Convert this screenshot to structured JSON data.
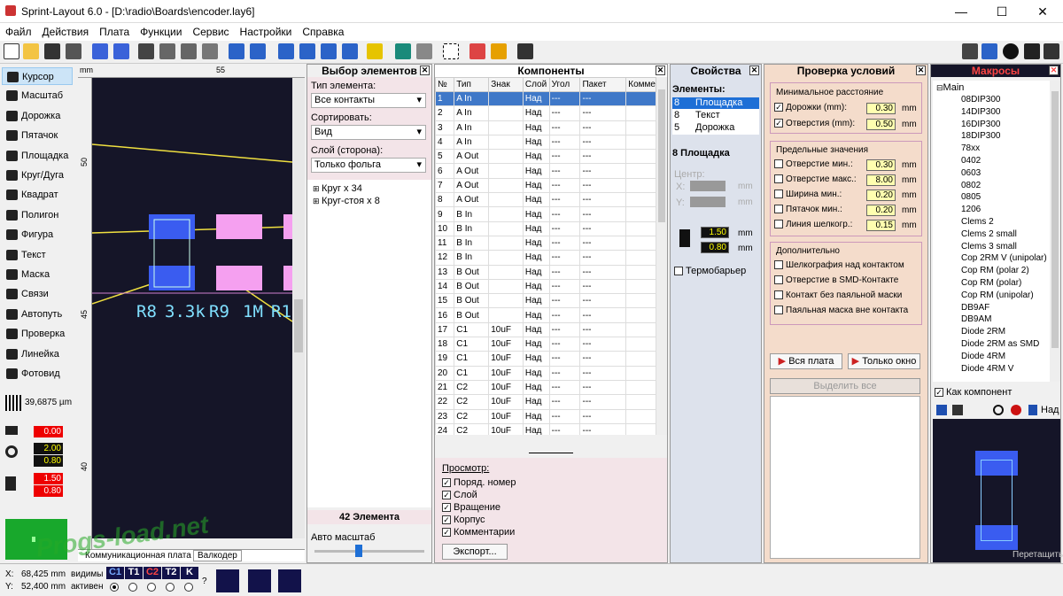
{
  "window": {
    "title": "Sprint-Layout 6.0 - [D:\\radio\\Boards\\encoder.lay6]",
    "min": "—",
    "max": "☐",
    "close": "✕"
  },
  "menu": [
    "Файл",
    "Действия",
    "Плата",
    "Функции",
    "Сервис",
    "Настройки",
    "Справка"
  ],
  "tools": [
    {
      "label": "Курсор",
      "icon": "cursor-icon",
      "active": true
    },
    {
      "label": "Масштаб",
      "icon": "zoom-icon"
    },
    {
      "label": "Дорожка",
      "icon": "track-icon"
    },
    {
      "label": "Пятачок",
      "icon": "pad-icon"
    },
    {
      "label": "Площадка",
      "icon": "smd-pad-icon"
    },
    {
      "label": "Круг/Дуга",
      "icon": "circle-icon"
    },
    {
      "label": "Квадрат",
      "icon": "square-icon"
    },
    {
      "label": "Полигон",
      "icon": "polygon-icon"
    },
    {
      "label": "Фигура",
      "icon": "shape-icon"
    },
    {
      "label": "Текст",
      "icon": "text-icon"
    },
    {
      "label": "Маска",
      "icon": "mask-icon"
    },
    {
      "label": "Связи",
      "icon": "connections-icon"
    },
    {
      "label": "Автопуть",
      "icon": "autoroute-icon"
    },
    {
      "label": "Проверка",
      "icon": "check-icon"
    },
    {
      "label": "Линейка",
      "icon": "ruler-icon"
    },
    {
      "label": "Фотовид",
      "icon": "photo-icon"
    }
  ],
  "grid": {
    "value": "39,6875 µm"
  },
  "left_fields": {
    "track_width": "0.00",
    "pad_outer": "2.00",
    "pad_inner": "0.80",
    "smd_w": "1.50",
    "smd_h": "0.80"
  },
  "ruler": {
    "unit": "mm",
    "top_tick": "55",
    "left_ticks": [
      "50",
      "45",
      "40"
    ]
  },
  "canvas": {
    "labels": [
      "R8",
      "3.3k",
      "R9",
      "1M",
      "R1"
    ]
  },
  "board_tabs": [
    "Коммуникационная плата",
    "Валкодер"
  ],
  "status": {
    "x_label": "X:",
    "x_value": "68,425 mm",
    "y_label": "Y:",
    "y_value": "52,400 mm",
    "visible": "видимы",
    "active": "активен",
    "layers": [
      "C1",
      "T1",
      "C2",
      "T2",
      "K"
    ],
    "help": "?"
  },
  "selection_panel": {
    "title": "Выбор элементов",
    "type_label": "Тип элемента:",
    "type_value": "Все контакты",
    "sort_label": "Сортировать:",
    "sort_value": "Вид",
    "layer_label": "Слой (сторона):",
    "layer_value": "Только фольга",
    "tree": [
      "Круг   x 34",
      "Круг-стоя   x 8"
    ],
    "count": "42 Элемента",
    "auto_zoom": "Авто масштаб",
    "auto_zoom_level": 0.4
  },
  "components": {
    "title": "Компоненты",
    "headers": [
      "№",
      "Тип",
      "Знак",
      "Слой",
      "Угол",
      "Пакет",
      "Комме"
    ],
    "rows": [
      [
        "1",
        "A In",
        "",
        "Над",
        "---",
        "---"
      ],
      [
        "2",
        "A In",
        "",
        "Над",
        "---",
        "---"
      ],
      [
        "3",
        "A In",
        "",
        "Над",
        "---",
        "---"
      ],
      [
        "4",
        "A In",
        "",
        "Над",
        "---",
        "---"
      ],
      [
        "5",
        "A Out",
        "",
        "Над",
        "---",
        "---"
      ],
      [
        "6",
        "A Out",
        "",
        "Над",
        "---",
        "---"
      ],
      [
        "7",
        "A Out",
        "",
        "Над",
        "---",
        "---"
      ],
      [
        "8",
        "A Out",
        "",
        "Над",
        "---",
        "---"
      ],
      [
        "9",
        "B In",
        "",
        "Над",
        "---",
        "---"
      ],
      [
        "10",
        "B In",
        "",
        "Над",
        "---",
        "---"
      ],
      [
        "11",
        "B In",
        "",
        "Над",
        "---",
        "---"
      ],
      [
        "12",
        "B In",
        "",
        "Над",
        "---",
        "---"
      ],
      [
        "13",
        "B Out",
        "",
        "Над",
        "---",
        "---"
      ],
      [
        "14",
        "B Out",
        "",
        "Над",
        "---",
        "---"
      ],
      [
        "15",
        "B Out",
        "",
        "Над",
        "---",
        "---"
      ],
      [
        "16",
        "B Out",
        "",
        "Над",
        "---",
        "---"
      ],
      [
        "17",
        "C1",
        "10uF",
        "Над",
        "---",
        "---"
      ],
      [
        "18",
        "C1",
        "10uF",
        "Над",
        "---",
        "---"
      ],
      [
        "19",
        "C1",
        "10uF",
        "Над",
        "---",
        "---"
      ],
      [
        "20",
        "C1",
        "10uF",
        "Над",
        "---",
        "---"
      ],
      [
        "21",
        "C2",
        "10uF",
        "Над",
        "---",
        "---"
      ],
      [
        "22",
        "C2",
        "10uF",
        "Над",
        "---",
        "---"
      ],
      [
        "23",
        "C2",
        "10uF",
        "Над",
        "---",
        "---"
      ],
      [
        "24",
        "C2",
        "10uF",
        "Над",
        "---",
        "---"
      ]
    ],
    "view_label": "Просмотр:",
    "view_options": [
      "Поряд. номер",
      "Слой",
      "Вращение",
      "Корпус",
      "Комментарии"
    ],
    "export": "Экспорт..."
  },
  "properties": {
    "title": "Свойства",
    "elements_label": "Элементы:",
    "elements": [
      {
        "n": "8",
        "name": "Площадка"
      },
      {
        "n": "8",
        "name": "Текст"
      },
      {
        "n": "5",
        "name": "Дорожка"
      }
    ],
    "selected": "8 Площадка",
    "center": "Центр:",
    "x": "X:",
    "y": "Y:",
    "unit": "mm",
    "w": "1.50",
    "h": "0.80",
    "thermal": "Термобарьер"
  },
  "drc": {
    "title": "Проверка условий",
    "min_title": "Минимальное расстояние",
    "min": [
      {
        "label": "Дорожки (mm):",
        "value": "0.30",
        "checked": true
      },
      {
        "label": "Отверстия (mm):",
        "value": "0.50",
        "checked": true
      }
    ],
    "limit_title": "Предельные значения",
    "limits": [
      {
        "label": "Отверстие мин.:",
        "value": "0.30"
      },
      {
        "label": "Отверстие макс.:",
        "value": "8.00"
      },
      {
        "label": "Ширина мин.:",
        "value": "0.20"
      },
      {
        "label": "Пятачок мин.:",
        "value": "0.20"
      },
      {
        "label": "Линия шелкогр.:",
        "value": "0.15"
      }
    ],
    "unit": "mm",
    "extra_title": "Дополнительно",
    "extra": [
      "Шелкография над контактом",
      "Отверстие в SMD-Контакте",
      "Контакт без паяльной маски",
      "Паяльная маска вне контакта"
    ],
    "btn_all": "Вся плата",
    "btn_window": "Только окно",
    "btn_select": "Выделить все"
  },
  "macros": {
    "title": "Макросы",
    "root": "Main",
    "items": [
      "08DIP300",
      "14DIP300",
      "16DIP300",
      "18DIP300",
      "78xx",
      "0402",
      "0603",
      "0802",
      "0805",
      "1206",
      "Clems 2",
      "Clems 2 small",
      "Clems 3 small",
      "Cop 2RM V (unipolar)",
      "Cop RM (polar 2)",
      "Cop RM (polar)",
      "Cop RM (unipolar)",
      "DB9AF",
      "DB9AM",
      "Diode 2RM",
      "Diode 2RM as SMD",
      "Diode 4RM",
      "Diode 4RM V"
    ],
    "as_component": "Как компонент",
    "up": "Над",
    "drag": "Перетащить"
  },
  "watermark": "Progs-load.net",
  "colors": {
    "board": "#151528",
    "pad_blue": "#3a5cf0",
    "pad_pink": "#f5a0f0",
    "silk": "#80e0ff",
    "track": "#f0e040",
    "selection": "#3f78c8"
  }
}
